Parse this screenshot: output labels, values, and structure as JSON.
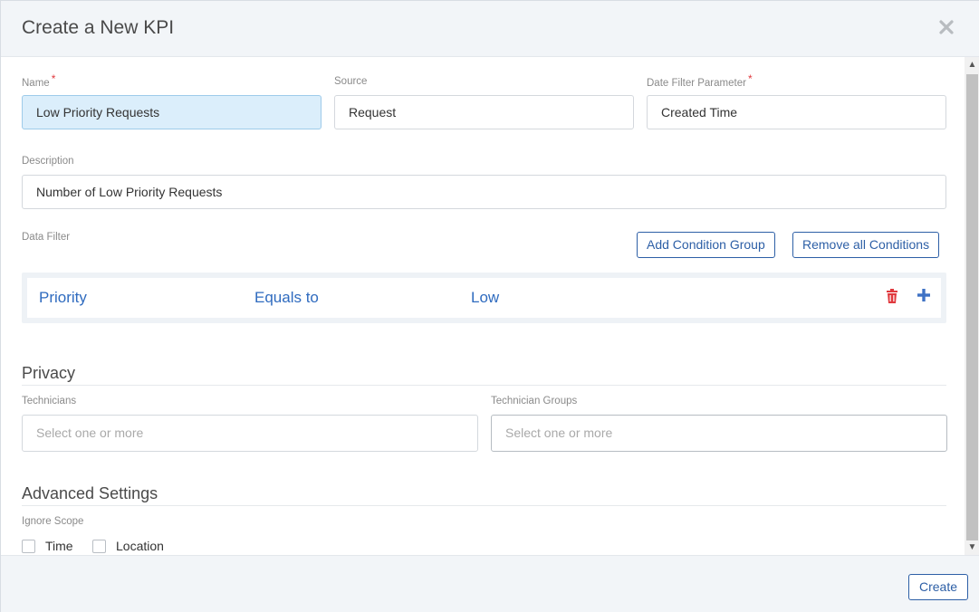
{
  "modal": {
    "title": "Create a New KPI",
    "close_icon": "close-icon"
  },
  "form": {
    "name": {
      "label": "Name",
      "required_mark": "*",
      "value": "Low Priority Requests"
    },
    "source": {
      "label": "Source",
      "value": "Request"
    },
    "date_filter": {
      "label": "Date Filter Parameter",
      "required_mark": "*",
      "value": "Created Time"
    },
    "description": {
      "label": "Description",
      "value": "Number of Low Priority Requests"
    },
    "data_filter": {
      "label": "Data Filter",
      "add_group_label": "Add Condition Group",
      "remove_all_label": "Remove all Conditions",
      "condition": {
        "field": "Priority",
        "operator": "Equals to",
        "value": "Low"
      },
      "delete_icon": "trash-icon",
      "add_icon": "plus-icon"
    }
  },
  "privacy": {
    "title": "Privacy",
    "technicians": {
      "label": "Technicians",
      "placeholder": "Select one or more"
    },
    "technician_groups": {
      "label": "Technician Groups",
      "placeholder": "Select one or more"
    }
  },
  "advanced": {
    "title": "Advanced Settings",
    "ignore_scope_label": "Ignore Scope",
    "options": [
      {
        "label": "Time",
        "checked": false
      },
      {
        "label": "Location",
        "checked": false
      }
    ]
  },
  "footer": {
    "create_label": "Create"
  },
  "colors": {
    "accent": "#2d5fa6",
    "link_blue": "#2f6bbf",
    "danger": "#e0393e",
    "focus_bg": "#dbeefb"
  }
}
